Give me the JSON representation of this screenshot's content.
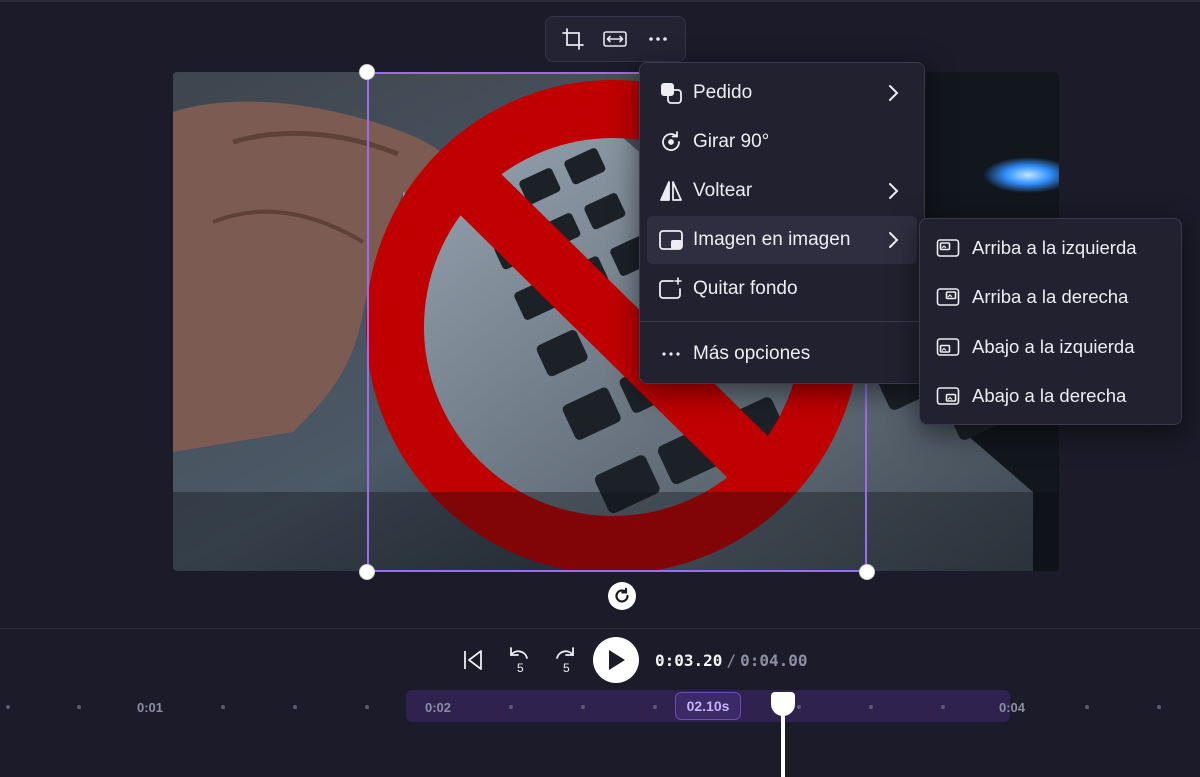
{
  "toolbar": {
    "buttons": [
      {
        "icon": "crop-icon"
      },
      {
        "icon": "fit-icon"
      },
      {
        "icon": "more-icon"
      }
    ]
  },
  "context_menu": {
    "items": [
      {
        "label": "Pedido",
        "icon": "order-icon",
        "has_submenu": true
      },
      {
        "label": "Girar 90°",
        "icon": "rotate-icon",
        "has_submenu": false
      },
      {
        "label": "Voltear",
        "icon": "flip-icon",
        "has_submenu": true
      },
      {
        "label": "Imagen en imagen",
        "icon": "picture-in-picture-icon",
        "has_submenu": true,
        "active": true
      },
      {
        "label": "Quitar fondo",
        "icon": "remove-background-icon",
        "has_submenu": false
      }
    ],
    "more": {
      "label": "Más opciones",
      "icon": "more-icon"
    }
  },
  "submenu": {
    "items": [
      {
        "label": "Arriba a la izquierda",
        "icon": "pip-top-left-icon"
      },
      {
        "label": "Arriba a la derecha",
        "icon": "pip-top-right-icon"
      },
      {
        "label": "Abajo a la izquierda",
        "icon": "pip-bottom-left-icon"
      },
      {
        "label": "Abajo a la derecha",
        "icon": "pip-bottom-right-icon"
      }
    ]
  },
  "transport": {
    "skip_back_seconds": "5",
    "skip_forward_seconds": "5",
    "current_time": "0:03.20",
    "separator": "/",
    "total_time": "0:04.00"
  },
  "timeline": {
    "ticks": [
      "0:01",
      "0:02",
      "0:04"
    ],
    "clip_duration": "02.10s"
  },
  "colors": {
    "background": "#1b1b29",
    "selection": "#9a6cf0",
    "clip": "#30224f",
    "prohibition_sign": "#c00000"
  }
}
